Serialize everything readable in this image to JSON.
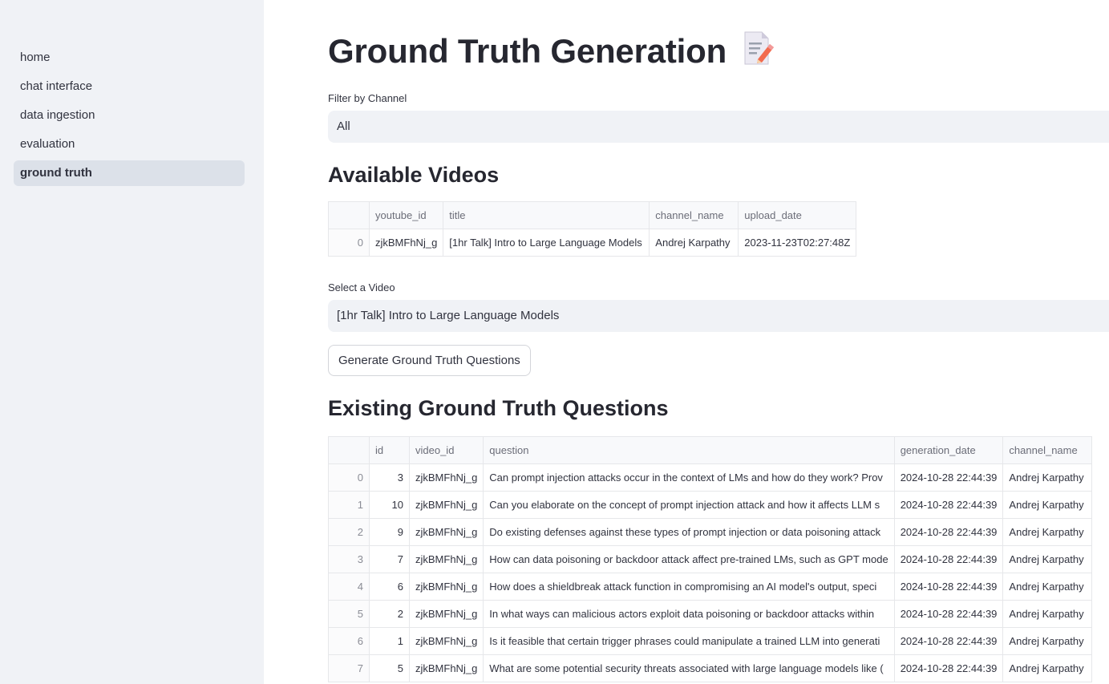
{
  "sidebar": {
    "items": [
      {
        "label": "home",
        "active": false
      },
      {
        "label": "chat interface",
        "active": false
      },
      {
        "label": "data ingestion",
        "active": false
      },
      {
        "label": "evaluation",
        "active": false
      },
      {
        "label": "ground truth",
        "active": true
      }
    ]
  },
  "main": {
    "title": "Ground Truth Generation",
    "title_icon": "memo-pencil-icon",
    "filter": {
      "label": "Filter by Channel",
      "value": "All"
    },
    "available_videos": {
      "heading": "Available Videos",
      "columns": [
        "",
        "youtube_id",
        "title",
        "channel_name",
        "upload_date"
      ],
      "rows": [
        [
          "0",
          "zjkBMFhNj_g",
          "[1hr Talk] Intro to Large Language Models",
          "Andrej Karpathy",
          "2023-11-23T02:27:48Z"
        ]
      ]
    },
    "video_select": {
      "label": "Select a Video",
      "value": "[1hr Talk] Intro to Large Language Models"
    },
    "generate_button": "Generate Ground Truth Questions",
    "existing_questions": {
      "heading": "Existing Ground Truth Questions",
      "columns": [
        "",
        "id",
        "video_id",
        "question",
        "generation_date",
        "channel_name"
      ],
      "rows": [
        [
          "0",
          "3",
          "zjkBMFhNj_g",
          "Can prompt injection attacks occur in the context of LMs and how do they work? Prov",
          "2024-10-28 22:44:39",
          "Andrej Karpathy"
        ],
        [
          "1",
          "10",
          "zjkBMFhNj_g",
          "Can you elaborate on the concept of prompt injection attack and how it affects LLM s",
          "2024-10-28 22:44:39",
          "Andrej Karpathy"
        ],
        [
          "2",
          "9",
          "zjkBMFhNj_g",
          "Do existing defenses against these types of prompt injection or data poisoning attack",
          "2024-10-28 22:44:39",
          "Andrej Karpathy"
        ],
        [
          "3",
          "7",
          "zjkBMFhNj_g",
          "How can data poisoning or backdoor attack affect pre-trained LMs, such as GPT mode",
          "2024-10-28 22:44:39",
          "Andrej Karpathy"
        ],
        [
          "4",
          "6",
          "zjkBMFhNj_g",
          "How does a shieldbreak attack function in compromising an AI model's output, speci",
          "2024-10-28 22:44:39",
          "Andrej Karpathy"
        ],
        [
          "5",
          "2",
          "zjkBMFhNj_g",
          "In what ways can malicious actors exploit data poisoning or backdoor attacks within",
          "2024-10-28 22:44:39",
          "Andrej Karpathy"
        ],
        [
          "6",
          "1",
          "zjkBMFhNj_g",
          "Is it feasible that certain trigger phrases could manipulate a trained LLM into generati",
          "2024-10-28 22:44:39",
          "Andrej Karpathy"
        ],
        [
          "7",
          "5",
          "zjkBMFhNj_g",
          "What are some potential security threats associated with large language models like (",
          "2024-10-28 22:44:39",
          "Andrej Karpathy"
        ]
      ]
    }
  }
}
